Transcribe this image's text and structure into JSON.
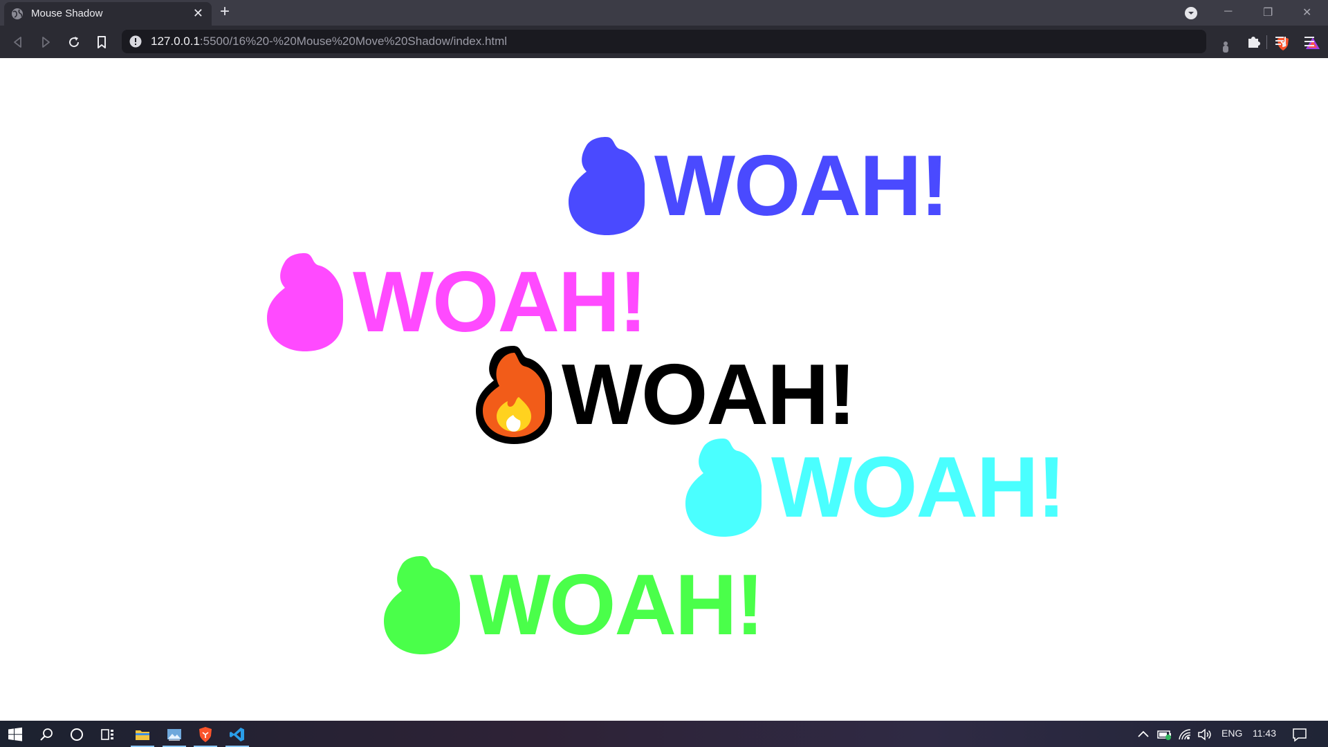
{
  "tab": {
    "title": "Mouse Shadow",
    "close": "✕",
    "new_tab": "+"
  },
  "window_controls": {
    "minimize": "─",
    "restore": "❐",
    "close": "✕"
  },
  "address": {
    "host": "127.0.0.1",
    "path": ":5500/16%20-%20Mouse%20Move%20Shadow/index.html"
  },
  "icons": {
    "tab": "globe-icon",
    "nav": [
      "back-icon",
      "forward-icon",
      "reload-icon",
      "bookmark-icon"
    ],
    "address": [
      "site-info-icon",
      "brave-shields-icon",
      "brave-rewards-icon"
    ],
    "toolbar": [
      "extension-icon",
      "puzzle-extensions-icon",
      "media-playlist-icon",
      "menu-icon"
    ],
    "taskbar": [
      "windows-start-icon",
      "search-icon",
      "cortana-icon",
      "task-view-icon",
      "file-explorer-icon",
      "image-app-icon",
      "brave-browser-icon",
      "vscode-icon"
    ],
    "tray": [
      "chevron-up-icon",
      "battery-icon",
      "wifi-icon",
      "volume-icon",
      "notification-icon"
    ]
  },
  "main": {
    "items": [
      {
        "label": "WOAH!",
        "color": "#4a4aff",
        "role": "shadow"
      },
      {
        "label": "WOAH!",
        "color": "#ff4aff",
        "role": "shadow"
      },
      {
        "label": "WOAH!",
        "color": "#000000",
        "role": "main"
      },
      {
        "label": "WOAH!",
        "color": "#4affff",
        "role": "shadow"
      },
      {
        "label": "WOAH!",
        "color": "#4aff4a",
        "role": "shadow"
      }
    ]
  },
  "tray": {
    "language": "ENG",
    "time": "11:43"
  }
}
